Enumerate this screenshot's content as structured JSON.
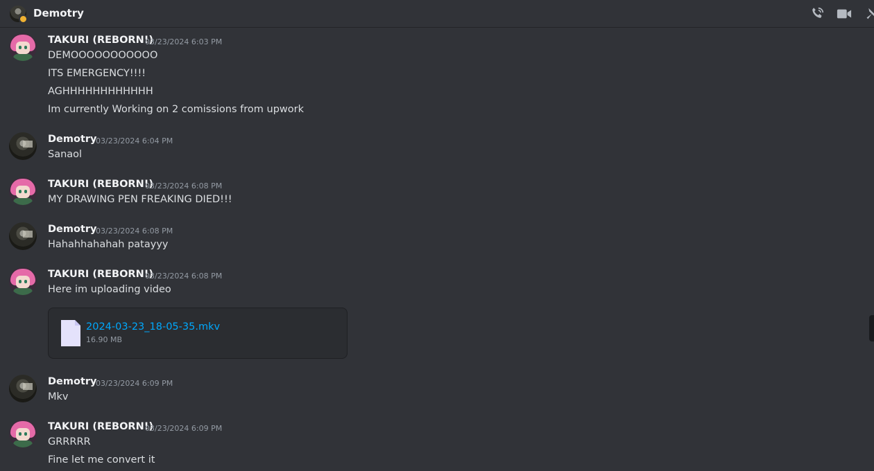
{
  "header": {
    "title": "Demotry"
  },
  "messages": [
    {
      "author": "TAKURI (REBORN!)",
      "avatar": "takuri",
      "time": "03/23/2024 6:03 PM",
      "lines": [
        "DEMOOOOOOOOOOO",
        "ITS EMERGENCY!!!!",
        "AGHHHHHHHHHHHH",
        "Im currently Working on 2 comissions from upwork"
      ]
    },
    {
      "author": "Demotry",
      "avatar": "demotry",
      "time": "03/23/2024 6:04 PM",
      "lines": [
        "Sanaol"
      ]
    },
    {
      "author": "TAKURI (REBORN!)",
      "avatar": "takuri",
      "time": "03/23/2024 6:08 PM",
      "lines": [
        "MY DRAWING PEN FREAKING DIED!!!"
      ]
    },
    {
      "author": "Demotry",
      "avatar": "demotry",
      "time": "03/23/2024 6:08 PM",
      "lines": [
        "Hahahhahahah patayyy"
      ]
    },
    {
      "author": "TAKURI (REBORN!)",
      "avatar": "takuri",
      "time": "03/23/2024 6:08 PM",
      "lines": [
        "Here im uploading video"
      ],
      "attachment": {
        "name": "2024-03-23_18-05-35.mkv",
        "size": "16.90 MB"
      }
    },
    {
      "author": "Demotry",
      "avatar": "demotry",
      "time": "03/23/2024 6:09 PM",
      "lines": [
        "Mkv"
      ]
    },
    {
      "author": "TAKURI (REBORN!)",
      "avatar": "takuri",
      "time": "03/23/2024 6:09 PM",
      "lines": [
        "GRRRRR",
        "Fine let me convert it"
      ]
    }
  ],
  "colors": {
    "background": "#313338",
    "link": "#00a8fc",
    "timestamp": "#949ba4"
  },
  "icons": [
    "phone-call-icon",
    "video-camera-icon",
    "pin-icon",
    "file-icon"
  ]
}
